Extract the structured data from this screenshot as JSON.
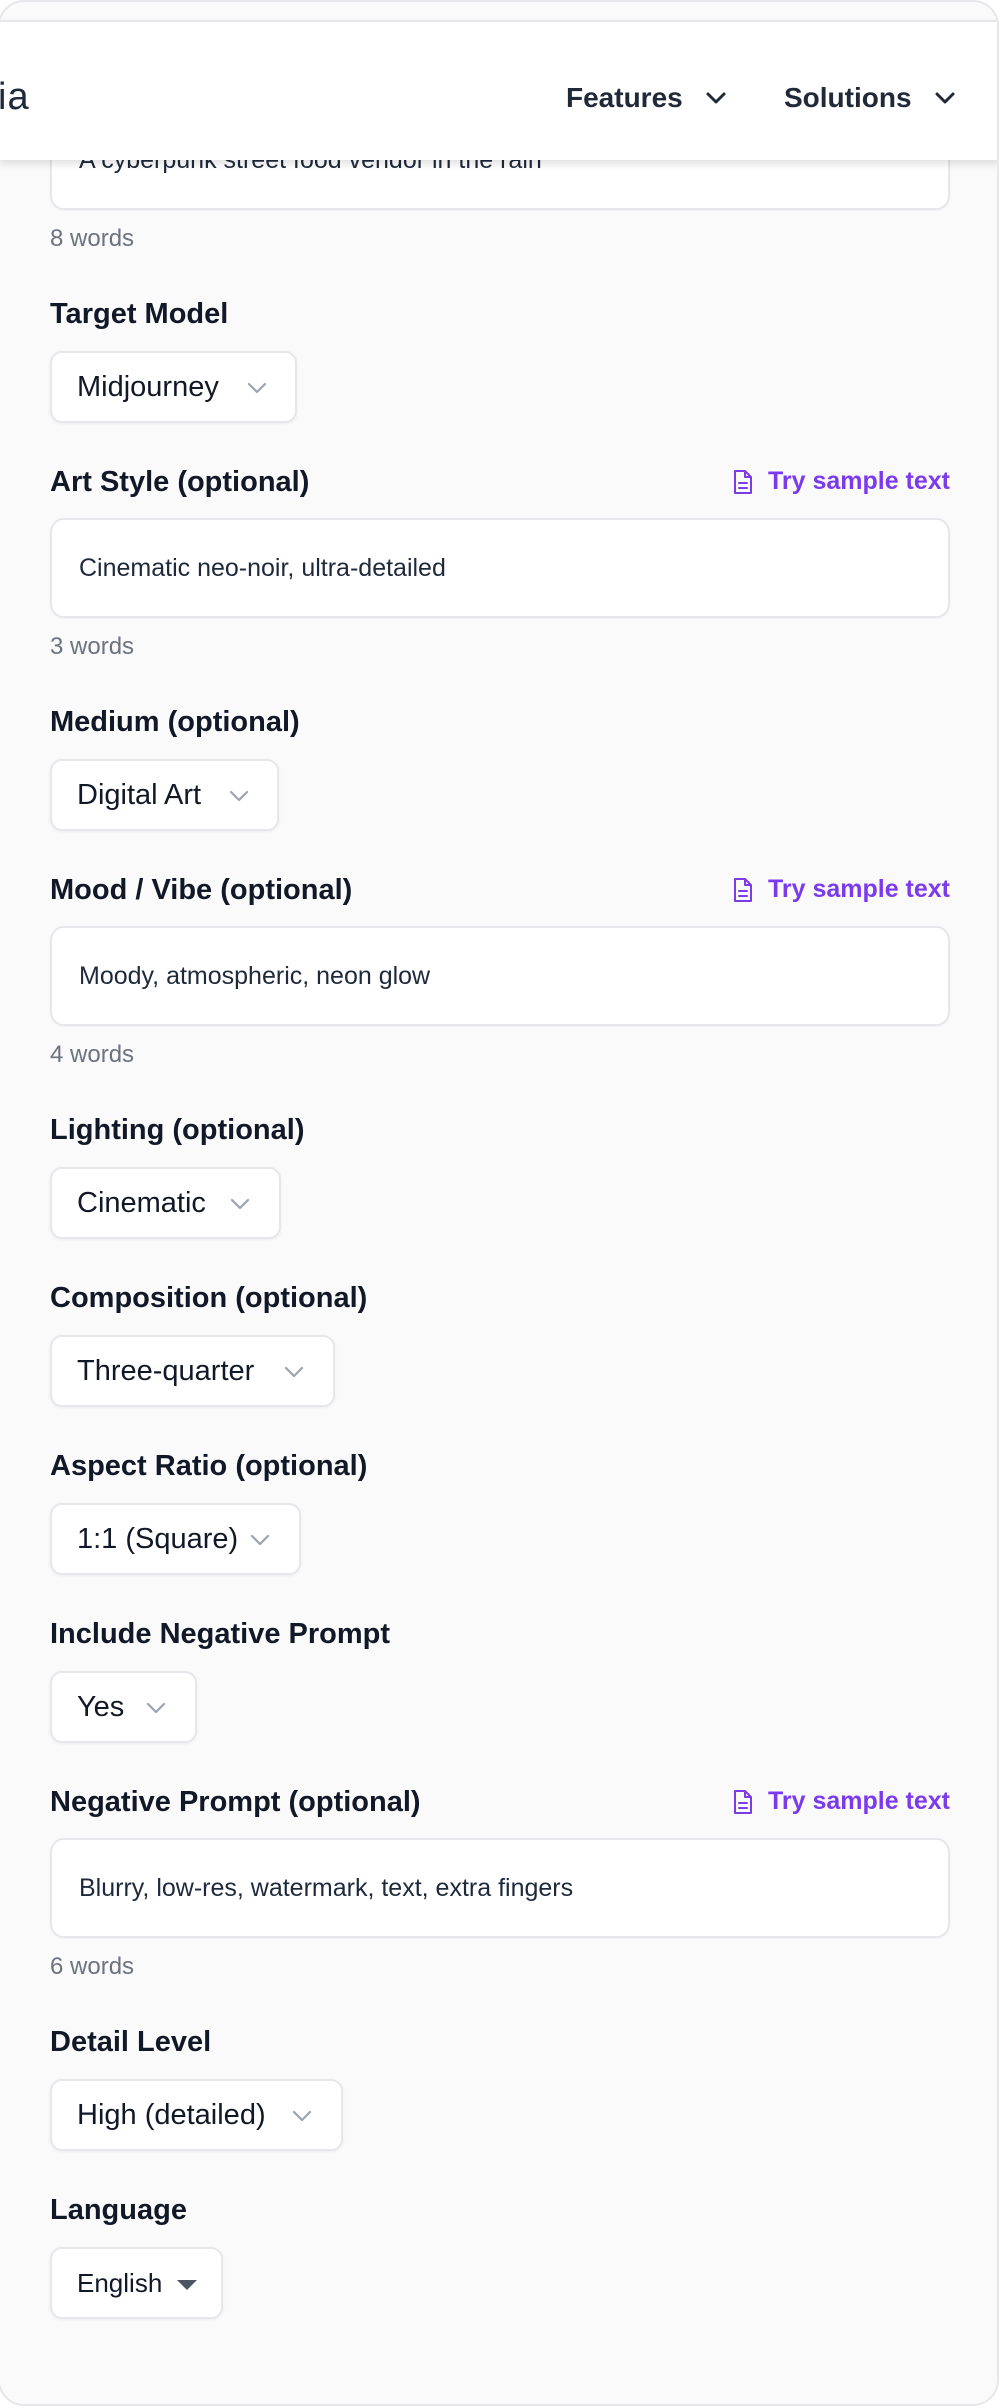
{
  "header": {
    "logo_fragment": "ia",
    "nav": [
      {
        "label": "Features"
      },
      {
        "label": "Solutions"
      }
    ]
  },
  "form": {
    "subject": {
      "value": "A cyberpunk street food vendor in the rain",
      "word_count": "8 words"
    },
    "target_model": {
      "label": "Target Model",
      "value": "Midjourney"
    },
    "art_style": {
      "label": "Art Style (optional)",
      "sample_link": "Try sample text",
      "value": "Cinematic neo-noir, ultra-detailed",
      "word_count": "3 words"
    },
    "medium": {
      "label": "Medium (optional)",
      "value": "Digital Art"
    },
    "mood": {
      "label": "Mood / Vibe (optional)",
      "sample_link": "Try sample text",
      "value": "Moody, atmospheric, neon glow",
      "word_count": "4 words"
    },
    "lighting": {
      "label": "Lighting (optional)",
      "value": "Cinematic"
    },
    "composition": {
      "label": "Composition (optional)",
      "value": "Three-quarter"
    },
    "aspect_ratio": {
      "label": "Aspect Ratio (optional)",
      "value": "1:1 (Square)"
    },
    "include_negative": {
      "label": "Include Negative Prompt",
      "value": "Yes"
    },
    "negative_prompt": {
      "label": "Negative Prompt (optional)",
      "sample_link": "Try sample text",
      "value": "Blurry, low-res, watermark, text, extra fingers",
      "word_count": "6 words"
    },
    "detail_level": {
      "label": "Detail Level",
      "value": "High (detailed)"
    },
    "language": {
      "label": "Language",
      "value": "English"
    }
  },
  "colors": {
    "accent": "#7c3aed",
    "text": "#111827",
    "muted": "#6b7280",
    "border": "#e5e7eb",
    "background": "#fafafa"
  },
  "icons": {
    "dropdown": "chevron-down-icon",
    "sample": "document-icon",
    "language_dropdown": "caret-down-icon"
  }
}
